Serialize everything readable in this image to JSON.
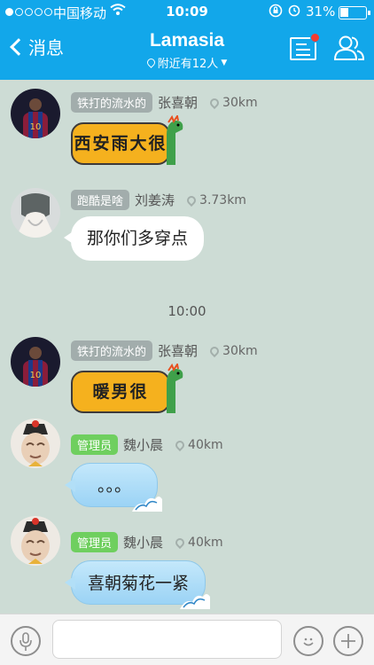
{
  "status_bar": {
    "carrier": "中国移动",
    "time": "10:09",
    "battery": "31%",
    "battery_level": 0.31,
    "signal_bars_filled": 1,
    "signal_bars_total": 5
  },
  "nav": {
    "back_label": "消息",
    "title": "Lamasia",
    "subtitle": "附近有12人",
    "accent": "#12a7ea"
  },
  "messages": [
    {
      "tag": "铁打的流水的",
      "name": "张喜朝",
      "distance": "30km",
      "sticker_text": "西安雨大很"
    },
    {
      "tag": "跑酷是啥",
      "name": "刘姜涛",
      "distance": "3.73km",
      "text": "那你们多穿点"
    },
    {
      "tag": "铁打的流水的",
      "name": "张喜朝",
      "distance": "30km",
      "sticker_text": "暖男很"
    },
    {
      "tag": "管理员",
      "name": "魏小晨",
      "distance": "40km",
      "text": "。。。"
    },
    {
      "tag": "管理员",
      "name": "魏小晨",
      "distance": "40km",
      "text": "喜朝菊花一紧"
    }
  ],
  "timestamp": "10:00",
  "colors": {
    "background": "#cddcd5",
    "admin_tag": "#6fcf5f",
    "user_tag": "#a2adac",
    "badge": "#f43b30"
  },
  "icons": {
    "list": "list-icon",
    "people": "people-icon",
    "voice": "microphone-icon",
    "emoji": "smiley-icon",
    "plus": "plus-icon"
  }
}
